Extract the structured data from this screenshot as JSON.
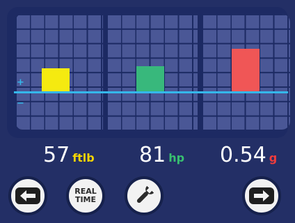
{
  "gauges": [
    {
      "label_value": "57",
      "unit": "ftlb",
      "unit_color": "#f5d400",
      "bar_color": "#f5ea10",
      "level": 0.12
    },
    {
      "label_value": "81",
      "unit": "hp",
      "unit_color": "#38c070",
      "bar_color": "#38b87c",
      "level": 0.13
    },
    {
      "label_value": "0.54",
      "unit": "g",
      "unit_color": "#f03c3c",
      "bar_color": "#f05656",
      "level": 0.22
    }
  ],
  "axis_signs": {
    "plus": "+",
    "minus": "−"
  },
  "buttons": {
    "back_icon": "arrow-left-icon",
    "real_time_line1": "REAL",
    "real_time_line2": "TIME",
    "settings_icon": "wrench-icon",
    "next_icon": "arrow-right-icon"
  },
  "colors": {
    "background": "#232f66",
    "grid_cell": "#4a5796",
    "baseline": "#35b7ea"
  }
}
